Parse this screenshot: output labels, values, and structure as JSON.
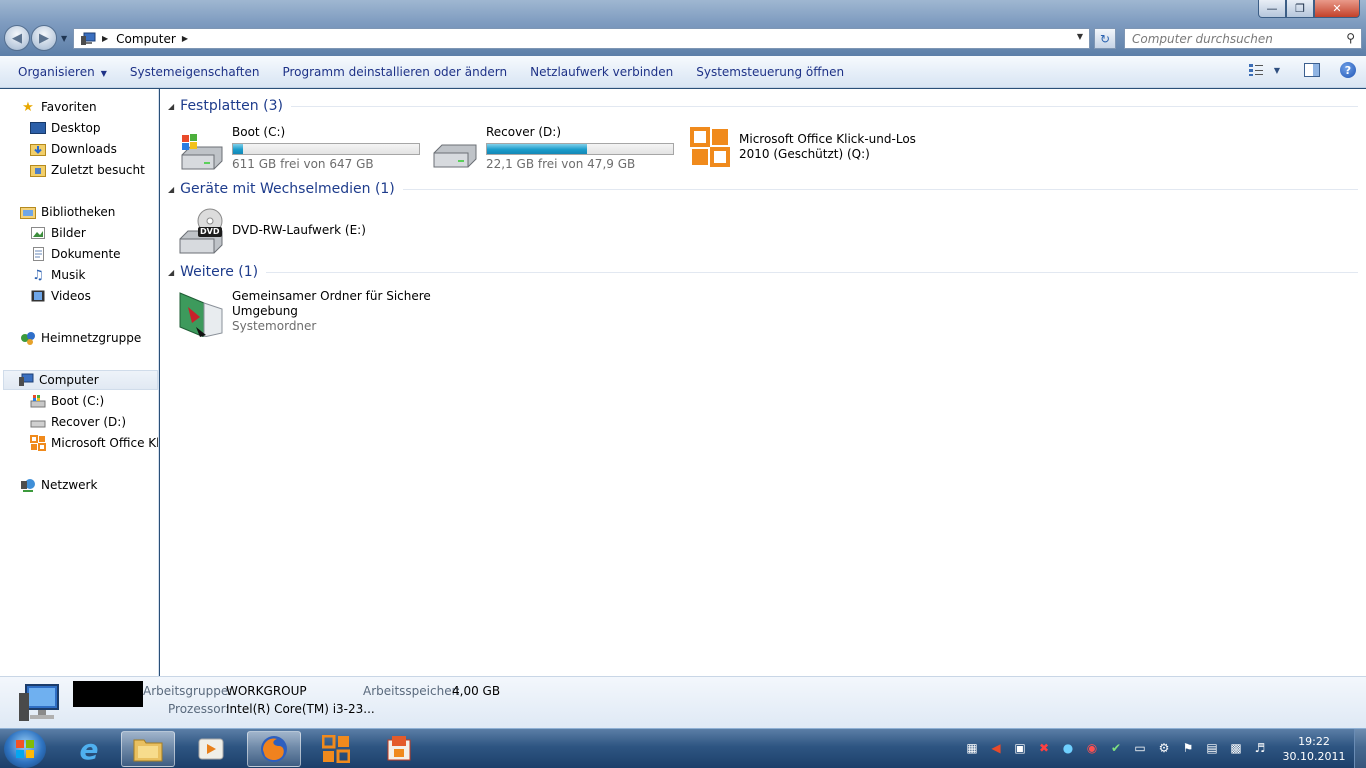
{
  "window": {
    "minimize_glyph": "—",
    "maximize_glyph": "❐",
    "close_glyph": "✕"
  },
  "address": {
    "crumb": "Computer"
  },
  "search": {
    "placeholder": "Computer durchsuchen"
  },
  "toolbar": {
    "organize": "Organisieren",
    "system_properties": "Systemeigenschaften",
    "uninstall": "Programm deinstallieren oder ändern",
    "map_drive": "Netzlaufwerk verbinden",
    "control_panel": "Systemsteuerung öffnen"
  },
  "nav": {
    "favorites": "Favoriten",
    "desktop": "Desktop",
    "downloads": "Downloads",
    "recent": "Zuletzt besucht",
    "libraries": "Bibliotheken",
    "pictures": "Bilder",
    "documents": "Dokumente",
    "music": "Musik",
    "videos": "Videos",
    "homegroup": "Heimnetzgruppe",
    "computer": "Computer",
    "boot": "Boot (C:)",
    "recover": "Recover (D:)",
    "office": "Microsoft Office Klic",
    "network": "Netzwerk"
  },
  "groups": {
    "hard_drives": "Festplatten (3)",
    "removable": "Geräte mit Wechselmedien (1)",
    "other": "Weitere (1)"
  },
  "drives": {
    "boot": {
      "name": "Boot (C:)",
      "free": "611 GB frei von 647 GB",
      "used_fraction": 0.056
    },
    "recover": {
      "name": "Recover (D:)",
      "free": "22,1 GB frei von 47,9 GB",
      "used_fraction": 0.54
    },
    "office": {
      "line1": "Microsoft Office Klick-und-Los",
      "line2": "2010 (Geschützt) (Q:)"
    },
    "dvd": {
      "name": "DVD-RW-Laufwerk (E:)",
      "badge": "DVD"
    },
    "shared": {
      "line1": "Gemeinsamer Ordner für Sichere",
      "line2": "Umgebung",
      "sub": "Systemordner"
    }
  },
  "details": {
    "workgroup_label": "Arbeitsgruppe:",
    "workgroup_value": "WORKGROUP",
    "memory_label": "Arbeitsspeicher:",
    "memory_value": "4,00 GB",
    "cpu_label": "Prozessor:",
    "cpu_value": "Intel(R) Core(TM) i3-23..."
  },
  "taskbar": {
    "time": "19:22",
    "date": "30.10.2011"
  },
  "colors": {
    "link_blue": "#1e3287",
    "group_title": "#1e3c8c",
    "bar_fill": "#1b9ccb"
  }
}
